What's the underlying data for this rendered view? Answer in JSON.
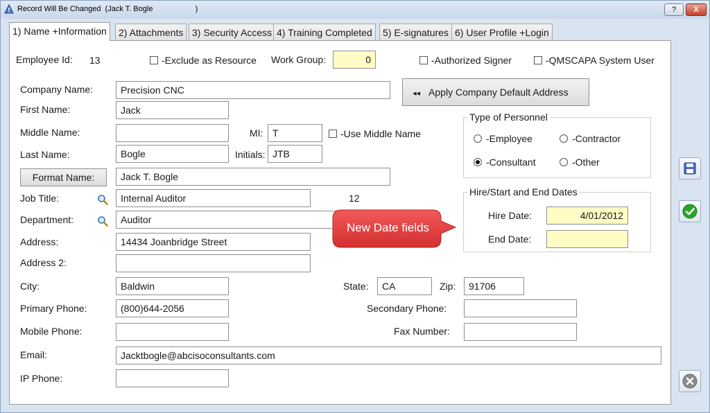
{
  "window": {
    "title": "Record Will Be Changed  (Jack T. Bogle                    )",
    "help_label": "?",
    "close_label": "X"
  },
  "tabs": [
    {
      "label": "1) Name +Information",
      "active": true
    },
    {
      "label": "2) Attachments"
    },
    {
      "label": "3) Security Access"
    },
    {
      "label": "4) Training Completed"
    },
    {
      "label": "5) E-signatures"
    },
    {
      "label": "6) User Profile +Login"
    }
  ],
  "top_row": {
    "employee_id_label": "Employee Id:",
    "employee_id_value": "13",
    "exclude_resource_label": "-Exclude as Resource",
    "work_group_label": "Work Group:",
    "work_group_value": "0",
    "authorized_signer_label": "-Authorized Signer",
    "qmscapa_user_label": "-QMSCAPA System User"
  },
  "form": {
    "company_name_label": "Company Name:",
    "company_name_value": "Precision CNC",
    "first_name_label": "First Name:",
    "first_name_value": "Jack",
    "middle_name_label": "Middle Name:",
    "middle_name_value": "",
    "mi_label": "MI:",
    "mi_value": "T",
    "use_middle_name_label": "-Use Middle Name",
    "last_name_label": "Last Name:",
    "last_name_value": "Bogle",
    "initials_label": "Initials:",
    "initials_value": "JTB",
    "format_name_button": "Format Name:",
    "formatted_name_value": "Jack T. Bogle",
    "job_title_label": "Job Title:",
    "job_title_value": "Internal Auditor",
    "job_title_code": "12",
    "department_label": "Department:",
    "department_value": "Auditor",
    "address_label": "Address:",
    "address_value": "14434 Joanbridge Street",
    "address2_label": "Address 2:",
    "address2_value": "",
    "city_label": "City:",
    "city_value": "Baldwin",
    "state_label": "State:",
    "state_value": "CA",
    "zip_label": "Zip:",
    "zip_value": "91706",
    "primary_phone_label": "Primary Phone:",
    "primary_phone_value": "(800)644-2056",
    "secondary_phone_label": "Secondary Phone:",
    "secondary_phone_value": "",
    "mobile_phone_label": "Mobile Phone:",
    "mobile_phone_value": "",
    "fax_number_label": "Fax Number:",
    "fax_number_value": "",
    "email_label": "Email:",
    "email_value": "Jacktbogle@abcisoconsultants.com",
    "ip_phone_label": "IP Phone:",
    "ip_phone_value": ""
  },
  "apply_default_address_button": "Apply Company Default Address",
  "personnel": {
    "title": "Type of Personnel",
    "employee_label": "-Employee",
    "contractor_label": "-Contractor",
    "consultant_label": "-Consultant",
    "other_label": "-Other",
    "selected": "consultant"
  },
  "dates": {
    "title": "Hire/Start and End Dates",
    "hire_date_label": "Hire Date:",
    "hire_date_value": "4/01/2012",
    "end_date_label": "End Date:",
    "end_date_value": ""
  },
  "callout": {
    "text": "New Date fields",
    "color": "#e03b3b"
  },
  "colors": {
    "highlight_field": "#fffdc5",
    "save_icon": "#3b5bb5",
    "ok_icon": "#2aa52a",
    "cancel_icon": "#8c8c8c"
  }
}
